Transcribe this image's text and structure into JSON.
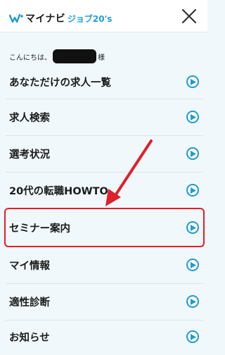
{
  "header": {
    "logo_main": "マイナビ",
    "logo_sub": "ジョブ20's",
    "close_icon": "close-icon"
  },
  "greeting": {
    "prefix": "こんにちは、",
    "suffix": "様"
  },
  "menu": {
    "items": [
      {
        "label": "あなただけの求人一覧",
        "icon": "chevron-right-circle-icon"
      },
      {
        "label": "求人検索",
        "icon": "chevron-right-circle-icon"
      },
      {
        "label": "選考状況",
        "icon": "chevron-right-circle-icon"
      },
      {
        "label": "20代の転職HOWTO",
        "icon": "chevron-right-circle-icon"
      },
      {
        "label": "セミナー案内",
        "icon": "chevron-right-circle-icon"
      },
      {
        "label": "マイ情報",
        "icon": "chevron-right-circle-icon"
      },
      {
        "label": "適性診断",
        "icon": "chevron-right-circle-icon"
      },
      {
        "label": "お知らせ",
        "icon": "chevron-right-circle-icon"
      }
    ]
  },
  "colors": {
    "accent": "#1e9bd0",
    "highlight": "#e0202a",
    "background": "#f1f8fb"
  }
}
